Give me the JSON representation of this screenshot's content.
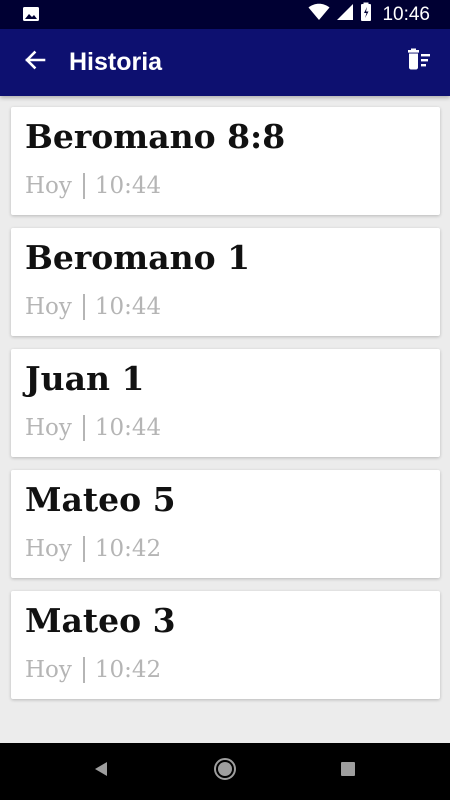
{
  "status_bar": {
    "time": "10:46",
    "icons": [
      "image-icon",
      "wifi-icon",
      "signal-icon",
      "battery-icon"
    ]
  },
  "app_bar": {
    "title": "Historia",
    "back_icon": "arrow-back-icon",
    "action_icon": "delete-sweep-icon"
  },
  "history": [
    {
      "title": "Beromano 8:8",
      "day": "Hoy",
      "time": "10:44"
    },
    {
      "title": "Beromano 1",
      "day": "Hoy",
      "time": "10:44"
    },
    {
      "title": "Juan 1",
      "day": "Hoy",
      "time": "10:44"
    },
    {
      "title": "Mateo 5",
      "day": "Hoy",
      "time": "10:42"
    },
    {
      "title": "Mateo 3",
      "day": "Hoy",
      "time": "10:42"
    }
  ],
  "nav_bar": {
    "icons": [
      "back-triangle-icon",
      "home-circle-icon",
      "recents-square-icon"
    ]
  },
  "colors": {
    "status_bar_bg": "#000033",
    "app_bar_bg": "#0d1070",
    "page_bg": "#ececec",
    "card_bg": "#ffffff",
    "title_text": "#111111",
    "meta_text": "#b5b5b5"
  }
}
